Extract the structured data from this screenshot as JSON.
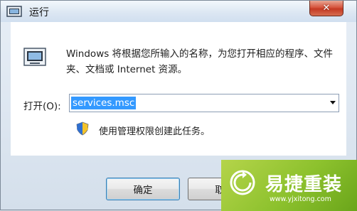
{
  "window": {
    "title": "运行",
    "close_glyph": "✕"
  },
  "dialog": {
    "description": "Windows 将根据您所输入的名称，为您打开相应的程序、文件夹、文档或 Internet 资源。",
    "open_label": "打开(O):",
    "input_value": "services.msc",
    "admin_note": "使用管理权限创建此任务。"
  },
  "buttons": {
    "ok": "确定",
    "cancel": "取"
  },
  "watermark": {
    "brand": "易捷重装",
    "url": "www.yjxitong.com"
  },
  "icons": {
    "title": "run-window-icon",
    "run": "run-program-icon",
    "shield": "uac-shield-icon",
    "dropdown": "chevron-down-icon",
    "watermark_logo": "refresh-circle-icon"
  },
  "colors": {
    "selection": "#3399ff",
    "close_button": "#c43a23",
    "watermark_green": "#8cc12d"
  }
}
